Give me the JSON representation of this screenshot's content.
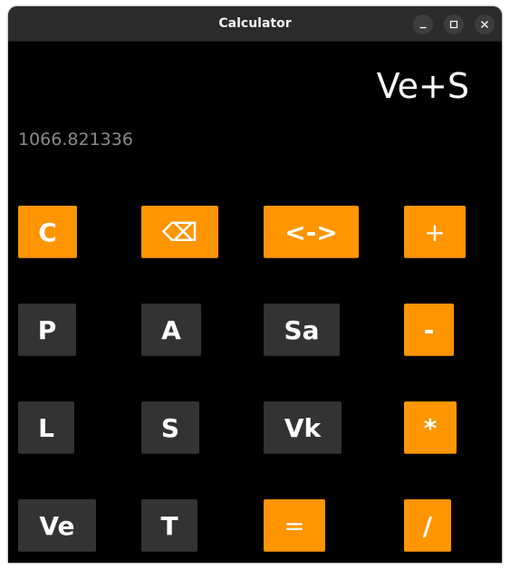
{
  "window": {
    "title": "Calculator"
  },
  "display": {
    "expression": "Ve+S",
    "result": "1066.821336"
  },
  "colors": {
    "operator": "#ff9500",
    "function": "#333333",
    "background": "#000000",
    "titlebar": "#2b2b2b"
  },
  "keys": {
    "clear": "C",
    "backspace": "⌫",
    "swap": "<->",
    "plus": "+",
    "p": "P",
    "a": "A",
    "sa": "Sa",
    "minus": "-",
    "l": "L",
    "s": "S",
    "vk": "Vk",
    "multiply": "*",
    "ve": "Ve",
    "t": "T",
    "equals": "=",
    "divide": "/"
  },
  "icons": {
    "minimize": "minimize-icon",
    "maximize": "maximize-icon",
    "close": "close-icon"
  }
}
